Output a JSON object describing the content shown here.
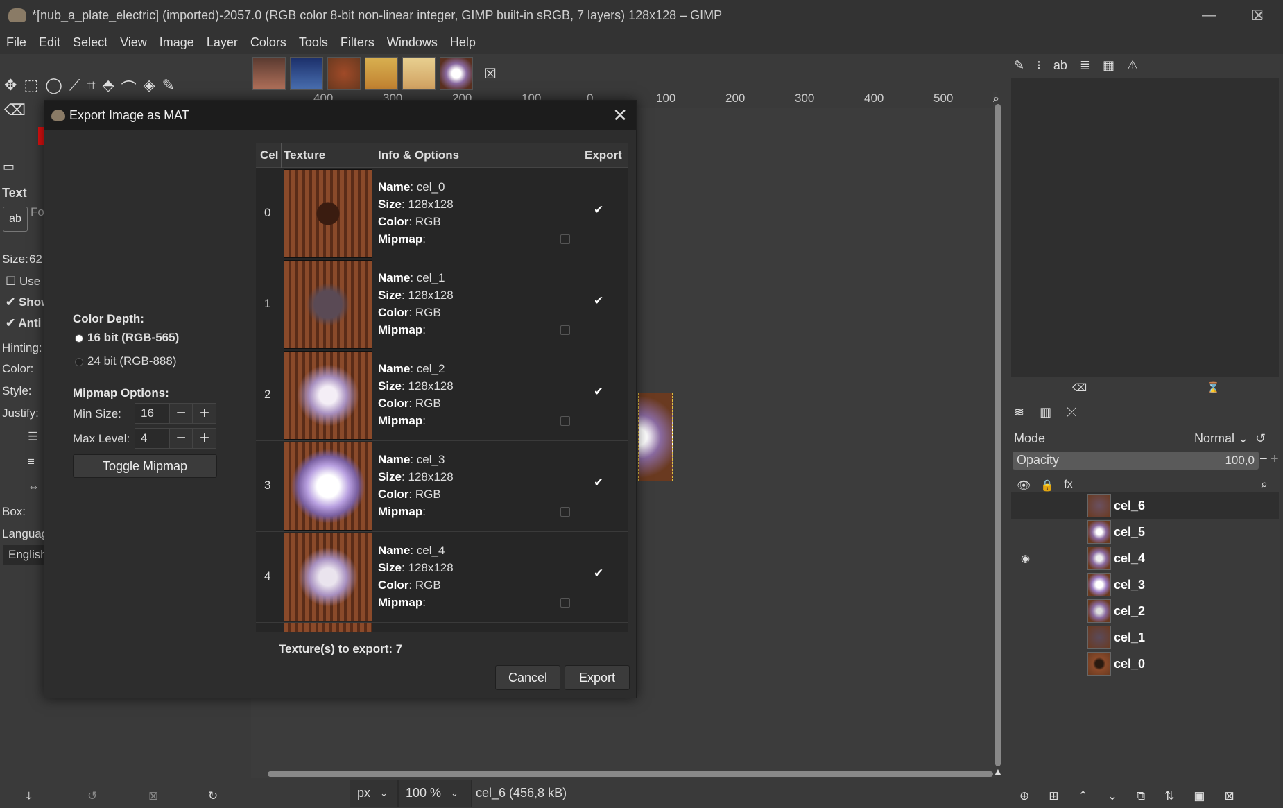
{
  "window": {
    "title": "*[nub_a_plate_electric] (imported)-2057.0 (RGB color 8-bit non-linear integer, GIMP built-in sRGB, 7 layers) 128x128 – GIMP",
    "minimize": "—",
    "maximize": "☐",
    "close": "✕"
  },
  "menu": [
    "File",
    "Edit",
    "Select",
    "View",
    "Image",
    "Layer",
    "Colors",
    "Tools",
    "Filters",
    "Windows",
    "Help"
  ],
  "image_tabs_close": "☒",
  "toolbox": {
    "text_header": "Text",
    "font_label": "Fo",
    "size_label": "Size:",
    "size_value": "62",
    "use_label": "Use",
    "show_label": "Show",
    "anti_label": "Anti",
    "hinting_label": "Hinting:",
    "color_label": "Color:",
    "style_label": "Style:",
    "justify_label": "Justify:",
    "box_label": "Box:",
    "language_label": "Languag",
    "language_value": "English"
  },
  "ruler": [
    "400",
    "300",
    "200",
    "100",
    "0",
    "100",
    "200",
    "300",
    "400",
    "500"
  ],
  "status": {
    "unit": "px",
    "zoom": "100 %",
    "layer_info": "cel_6 (456,8 kB)"
  },
  "layers_panel": {
    "mode_label": "Mode",
    "mode_value": "Normal",
    "opacity_label": "Opacity",
    "opacity_value": "100,0",
    "layers": [
      {
        "name": "cel_6",
        "visible": false
      },
      {
        "name": "cel_5",
        "visible": false
      },
      {
        "name": "cel_4",
        "visible": true
      },
      {
        "name": "cel_3",
        "visible": false
      },
      {
        "name": "cel_2",
        "visible": false
      },
      {
        "name": "cel_1",
        "visible": false
      },
      {
        "name": "cel_0",
        "visible": false
      }
    ]
  },
  "dialog": {
    "title": "Export Image as MAT",
    "color_depth_label": "Color Depth:",
    "opt_16": "16 bit (RGB-565)",
    "opt_24": "24 bit (RGB-888)",
    "mipmap_options_label": "Mipmap Options:",
    "min_size_label": "Min Size:",
    "min_size_value": "16",
    "max_level_label": "Max Level:",
    "max_level_value": "4",
    "toggle_mipmap": "Toggle Mipmap",
    "columns": [
      "Cel",
      "Texture",
      "Info & Options",
      "Export"
    ],
    "rows": [
      {
        "cel": "0",
        "name": "cel_0",
        "size": "128x128",
        "color": "RGB"
      },
      {
        "cel": "1",
        "name": "cel_1",
        "size": "128x128",
        "color": "RGB"
      },
      {
        "cel": "2",
        "name": "cel_2",
        "size": "128x128",
        "color": "RGB"
      },
      {
        "cel": "3",
        "name": "cel_3",
        "size": "128x128",
        "color": "RGB"
      },
      {
        "cel": "4",
        "name": "cel_4",
        "size": "128x128",
        "color": "RGB"
      }
    ],
    "name_label": "Name",
    "size_label": "Size",
    "color_label": "Color",
    "mipmap_label": "Mipmap",
    "textures_to_export": "Texture(s) to export: 7",
    "cancel": "Cancel",
    "export": "Export"
  }
}
